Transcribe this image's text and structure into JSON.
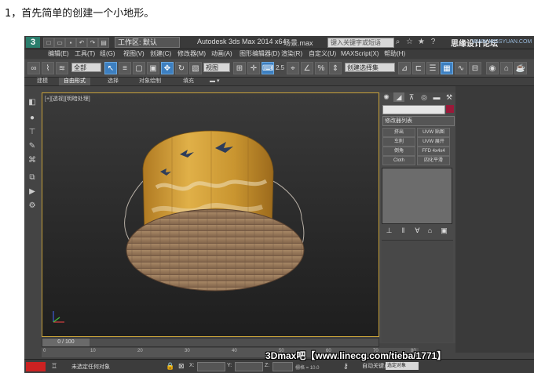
{
  "caption": "1，首先简单的创建一个小地形。",
  "titlebar": {
    "logo": "3",
    "workspace": "工作区: 默认",
    "app_title": "Autodesk 3ds Max  2014 x64",
    "file_name": "场景.max",
    "search_placeholder": "键入关键字或短语",
    "watermark": "思缘设计论坛",
    "watermark_site": "WWW.MISSYUAN.COM"
  },
  "menu": [
    "编辑(E)",
    "工具(T)",
    "组(G)",
    "视图(V)",
    "创建(C)",
    "修改器(M)",
    "动画(A)",
    "图形编辑器(D)",
    "渲染(R)",
    "自定义(U)",
    "MAXScript(X)",
    "帮助(H)"
  ],
  "toolbar": {
    "filter_select": "全部",
    "view_select": "视图",
    "snap_value": "2.5",
    "named_selection": "创建选择集"
  },
  "ribbon": {
    "tabs": [
      "建模",
      "自由形式",
      "选择",
      "对象绘制",
      "填充"
    ]
  },
  "viewport": {
    "label": "[+][透视][明暗处理]"
  },
  "command_panel": {
    "modifier_list": "修改器列表",
    "buttons": [
      "挤出",
      "UVW 贴图",
      "车削",
      "UVW 展开",
      "倒角",
      "FFD 4x4x4",
      "Cloth",
      "四化平滑"
    ]
  },
  "time": {
    "slider": "0 / 100",
    "ticks": [
      "0",
      "10",
      "20",
      "30",
      "40",
      "50",
      "60",
      "70",
      "80"
    ]
  },
  "status": {
    "text": "未选定任何对象",
    "x_label": "X:",
    "y_label": "Y:",
    "z_label": "Z:",
    "grid": "栅格 = 10.0",
    "autokey": "自动关键点",
    "selection_set": "选定对象"
  },
  "watermark_bottom": "3Dmax吧【www.linecg.com/tieba/1771】",
  "colors": {
    "accent_blue": "#3d7fc0",
    "viewport_border": "#c8a23a",
    "swatch": "#9a1a3a"
  }
}
